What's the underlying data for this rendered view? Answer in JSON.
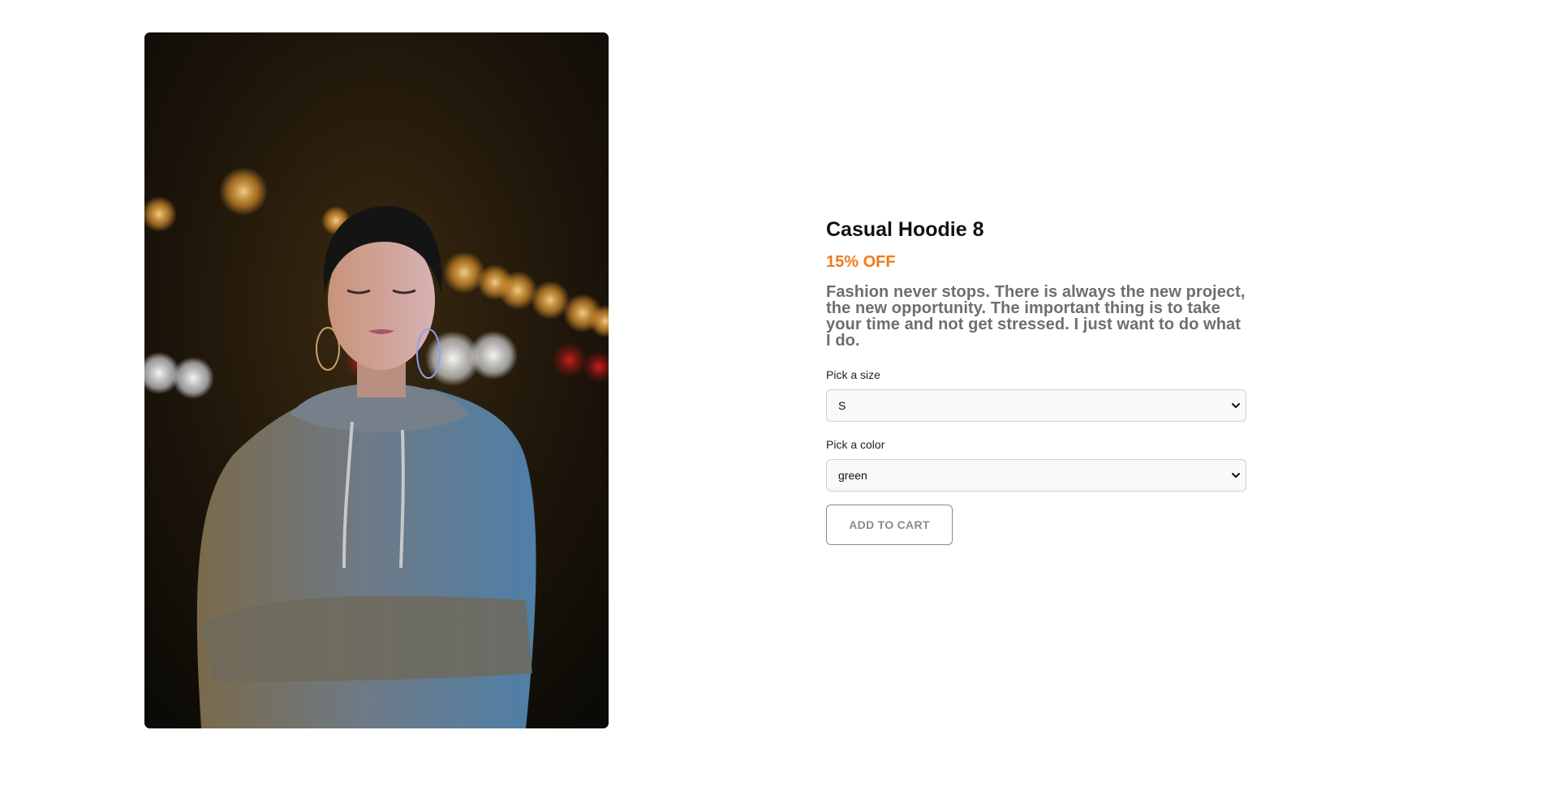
{
  "product": {
    "image_alt": "Woman in grey hoodie with arms crossed at night",
    "title": "Casual Hoodie 8",
    "discount": "15% OFF",
    "description": "Fashion never stops. There is always the new project, the new opportunity. The important thing is to take your time and not get stressed. I just want to do what I do."
  },
  "size_select": {
    "label": "Pick a size",
    "value": "S"
  },
  "color_select": {
    "label": "Pick a color",
    "value": "green"
  },
  "actions": {
    "add_to_cart": "ADD TO CART"
  },
  "colors": {
    "discount": "#f07a1a",
    "description": "#6e6e6e",
    "title": "#111111"
  },
  "icons": {
    "select_arrow": "chevron-down-icon"
  }
}
